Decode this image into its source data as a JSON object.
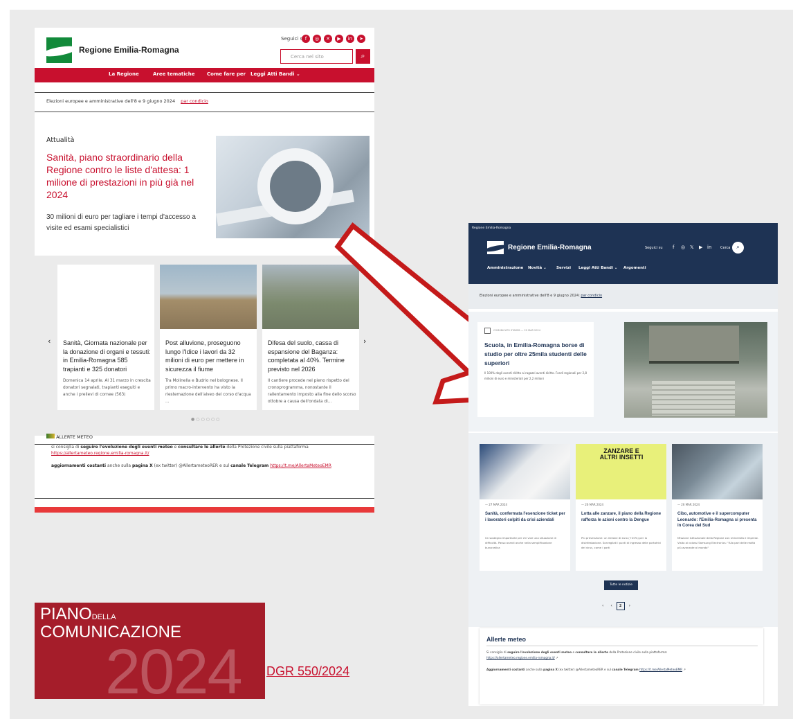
{
  "old_site": {
    "brand": "Regione Emilia-Romagna",
    "seguici": "Seguici su",
    "search_placeholder": "Cerca nel sito",
    "nav": [
      "La Regione",
      "Aree tematiche",
      "Come fare per",
      "Leggi Atti Bandi ⌄"
    ],
    "elezioni": "Elezioni europee e amministrative dell'8 e 9 giugno 2024",
    "par_condicio": "par condicio",
    "attualita_label": "Attualità",
    "hero_title": "Sanità, piano straordinario della Regione contro le liste d'attesa: 1 milione di prestazioni in più già nel 2024",
    "hero_sub": "30 milioni di euro per tagliare i tempi d'accesso a visite ed esami specialistici",
    "slider": [
      {
        "title": "Sanità, Giornata nazionale per la donazione di organi e tessuti: in Emilia-Romagna 585 trapianti e 325 donatori",
        "text": "Domenica 14 aprile. Al 31 marzo in crescita donatori segnalati, trapianti eseguiti e anche i prelievi di cornee (563)"
      },
      {
        "title": "Post alluvione, proseguono lungo l'Idice i lavori da 32 milioni di euro per mettere in sicurezza il fiume",
        "text": "Tra Molinella e Budrio nel bolognese. Il primo macro-intervento ha visto la riestemazione dell'alveo del corso d'acqua ..."
      },
      {
        "title": "Difesa del suolo, cassa di espansione del Baganza: completata al 40%. Termine previsto nel 2026",
        "text": "Il cantiere procede nel pieno rispetto del cronoprogramma, nonostante il rallentamento imposto alla fine dello scorso ottobre a causa dell'ondata di..."
      }
    ],
    "allerte_title": "ALLERTE METEO",
    "allerte_p1_a": "si consiglia di ",
    "allerte_p1_b": "seguire l'evoluzione degli eventi meteo",
    "allerte_p1_c": " e ",
    "allerte_p1_d": "consultare le allerte",
    "allerte_p1_e": " della Protezione civile sulla piattaforma",
    "allerte_link1": "https://allertameteo.regione.emilia-romagna.it/",
    "allerte_p2_a": "aggiornamenti costanti",
    "allerte_p2_b": " anche sulla ",
    "allerte_p2_c": "pagina X",
    "allerte_p2_d": " (ex twitter) @AllertameteoRER e sul ",
    "allerte_p2_e": "canale Telegram",
    "allerte_link2": "https://t.me/AllertaMeteoEMR"
  },
  "piano": {
    "line1": "PIANO",
    "della": "DELLA",
    "line2": "COMUNICAZIONE",
    "year": "2024",
    "dgr": "DGR 550/2024"
  },
  "new_site": {
    "small": "Regione Emilia-Romagna",
    "brand": "Regione Emilia-Romagna",
    "seguici": "Seguici su",
    "cerca": "Cerca",
    "nav": [
      "Amministrazione",
      "Novità ⌄",
      "Servizi",
      "Leggi Atti Bandi ⌄",
      "Argomenti"
    ],
    "elezioni": "Elezioni europee e amministrative dell'8 e 9 giugno 2024: ",
    "par_condicio": "par condicio",
    "feat_meta": "COMUNICATO STAMPA — 29 MAR 2024",
    "feat_title": "Scuola, in Emilia-Romagna borse di studio per oltre 25mila studenti delle superiori",
    "feat_text": "Il 100% degli aventi diritto ai ragazzi aventi diritto. Fondi regionali per 2,8 milioni di euro e ministeriali per 2,2 milioni",
    "news": [
      {
        "date": "— 27 MAR 2024",
        "title": "Sanità, confermata l'esenzione ticket per i lavoratori colpiti da crisi aziendali",
        "text": "Un sostegno importante per chi vive una situazione di difficoltà. Passo avanti anche nella semplificazione burocratica"
      },
      {
        "date": "— 26 MAR 2024",
        "title": "Lotta alle zanzare, il piano della Regione rafforza le azioni contro la Dengue",
        "text": "Più prevenzione: un milione di euro (+20%) per la disinfestazione. Sorvegliati i punti di ingresso delle portatrici del virus, come i porti"
      },
      {
        "date": "— 26 MAR 2024",
        "title": "Cibo, automotive e il supercomputer Leonardo: l'Emilia-Romagna si presenta in Corea del Sud",
        "text": "Missione istituzionale della Regione con Università e imprese. Visita ai colossi Samsung Electronics: \"Alla pari delle realtà più avanzate al mondo\""
      }
    ],
    "zanzare": "ZANZARE E ALTRI INSETTI",
    "tutte": "Tutte le notizie",
    "page_current": "2",
    "meteo_title": "Allerte meteo",
    "meteo_p1_a": "Si consiglia di ",
    "meteo_p1_b": "seguire l'evoluzione degli eventi meteo",
    "meteo_p1_c": " e ",
    "meteo_p1_d": "consultare le allerte",
    "meteo_p1_e": " della Protezione civile sulla piattaforma:",
    "meteo_link1": "https://allertameteo.regione.emilia-romagna.it/",
    "meteo_p2_a": "Aggiornamenti costanti",
    "meteo_p2_b": " anche sulla ",
    "meteo_p2_c": "pagina X",
    "meteo_p2_d": " (ex twitter) @AllertameteoRER e sul ",
    "meteo_p2_e": "canale Telegram",
    "meteo_link2": "https://t.me/AllertaMeteoEMR"
  },
  "colors": {
    "old_red": "#c8102e",
    "new_navy": "#1e3354",
    "piano_red": "#a51d2a"
  }
}
